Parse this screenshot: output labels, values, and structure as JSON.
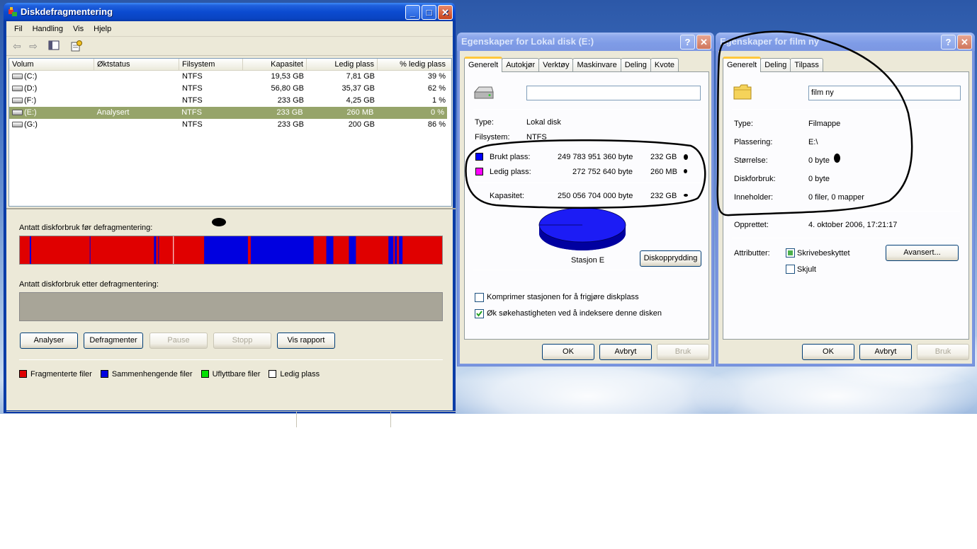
{
  "colors": {
    "fragmented": "#e00000",
    "contiguous": "#0000e0",
    "unmovable": "#00e000",
    "free": "#ffffff",
    "after_bar": "#a8a598",
    "used_space": "#0000ff",
    "free_space": "#ff00ff",
    "selection": "#96a46a"
  },
  "defrag": {
    "title": "Diskdefragmentering",
    "menu": [
      "Fil",
      "Handling",
      "Vis",
      "Hjelp"
    ],
    "columns": [
      "Volum",
      "Øktstatus",
      "Filsystem",
      "Kapasitet",
      "Ledig plass",
      "% ledig plass"
    ],
    "rows": [
      {
        "vol": "(C:)",
        "status": "",
        "fs": "NTFS",
        "cap": "19,53 GB",
        "free": "7,81 GB",
        "pct": "39 %"
      },
      {
        "vol": "(D:)",
        "status": "",
        "fs": "NTFS",
        "cap": "56,80 GB",
        "free": "35,37 GB",
        "pct": "62 %"
      },
      {
        "vol": "(F:)",
        "status": "",
        "fs": "NTFS",
        "cap": "233 GB",
        "free": "4,25 GB",
        "pct": "1 %"
      },
      {
        "vol": "(E:)",
        "status": "Analysert",
        "fs": "NTFS",
        "cap": "233 GB",
        "free": "260 MB",
        "pct": "0 %"
      },
      {
        "vol": "(G:)",
        "status": "",
        "fs": "NTFS",
        "cap": "233 GB",
        "free": "200 GB",
        "pct": "86 %"
      }
    ],
    "before_label": "Antatt diskforbruk før defragmentering:",
    "after_label": "Antatt diskforbruk etter defragmentering:",
    "buttons": {
      "analyze": "Analyser",
      "defrag": "Defragmenter",
      "pause": "Pause",
      "stop": "Stopp",
      "report": "Vis rapport"
    },
    "legend": {
      "fragmented": "Fragmenterte filer",
      "contiguous": "Sammenhengende filer",
      "unmovable": "Uflyttbare filer",
      "free": "Ledig plass"
    }
  },
  "disk_props": {
    "title": "Egenskaper for Lokal disk (E:)",
    "tabs": [
      "Generelt",
      "Autokjør",
      "Verktøy",
      "Maskinvare",
      "Deling",
      "Kvote"
    ],
    "label_value": "",
    "type_label": "Type:",
    "type_value": "Lokal disk",
    "fs_label": "Filsystem:",
    "fs_value": "NTFS",
    "used_label": "Brukt plass:",
    "used_bytes": "249 783 951 360 byte",
    "used_h": "232 GB",
    "free_label": "Ledig plass:",
    "free_bytes": "272 752 640 byte",
    "free_h": "260 MB",
    "cap_label": "Kapasitet:",
    "cap_bytes": "250 056 704 000 byte",
    "cap_h": "232 GB",
    "drive_caption": "Stasjon E",
    "cleanup_button": "Diskopprydding",
    "compress_label": "Komprimer stasjonen for å frigjøre diskplass",
    "index_label": "Øk søkehastigheten ved å indeksere denne disken",
    "ok": "OK",
    "cancel": "Avbryt",
    "apply": "Bruk"
  },
  "folder_props": {
    "title": "Egenskaper for film ny",
    "tabs": [
      "Generelt",
      "Deling",
      "Tilpass"
    ],
    "name_value": "film ny",
    "type_label": "Type:",
    "type_value": "Filmappe",
    "location_label": "Plassering:",
    "location_value": "E:\\",
    "size_label": "Størrelse:",
    "size_value": "0 byte",
    "disk_usage_label": "Diskforbruk:",
    "disk_usage_value": "0 byte",
    "contains_label": "Inneholder:",
    "contains_value": "0 filer, 0 mapper",
    "created_label": "Opprettet:",
    "created_value": "4. oktober 2006, 17:21:17",
    "attributes_label": "Attributter:",
    "readonly_label": "Skrivebeskyttet",
    "hidden_label": "Skjult",
    "advanced_button": "Avansert...",
    "ok": "OK",
    "cancel": "Avbryt",
    "apply": "Bruk"
  }
}
